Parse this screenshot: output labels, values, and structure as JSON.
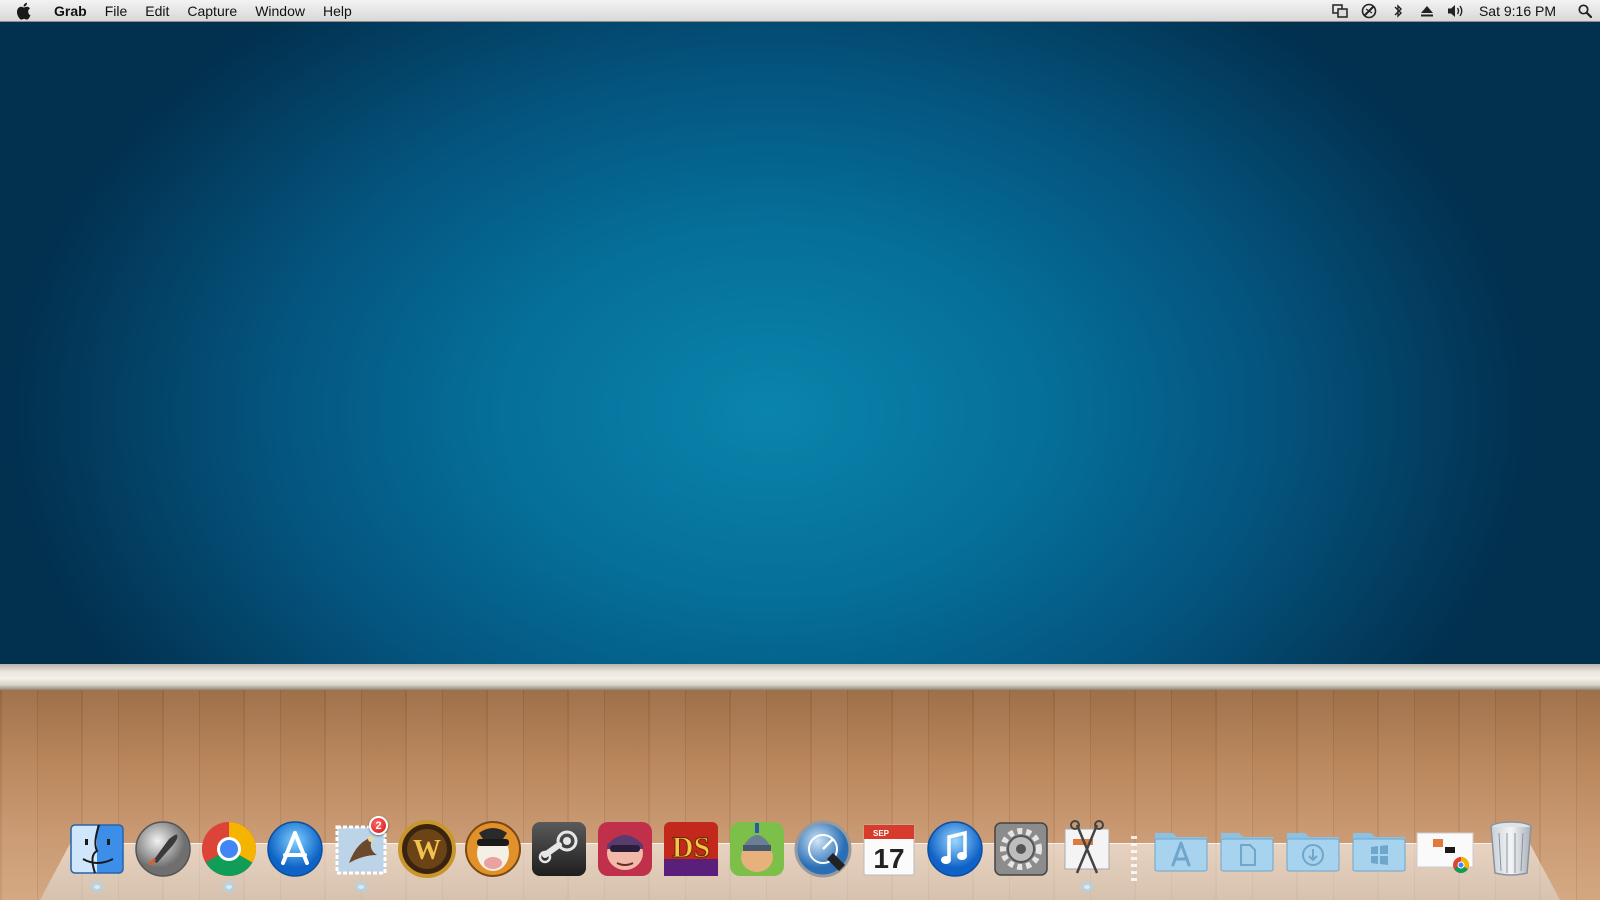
{
  "menubar": {
    "app_name": "Grab",
    "menus": [
      "File",
      "Edit",
      "Capture",
      "Window",
      "Help"
    ],
    "status_icons": [
      "window-switch-icon",
      "safari-sync-icon",
      "bluetooth-icon",
      "eject-icon",
      "volume-icon"
    ],
    "clock": "Sat 9:16 PM"
  },
  "dock": {
    "apps": [
      {
        "name": "finder-icon",
        "running": true
      },
      {
        "name": "launchpad-icon",
        "running": false
      },
      {
        "name": "chrome-icon",
        "running": true
      },
      {
        "name": "app-store-icon",
        "running": false
      },
      {
        "name": "mail-icon",
        "running": true,
        "badge": "2"
      },
      {
        "name": "world-of-warcraft-icon",
        "running": false
      },
      {
        "name": "cartoon-cow-game-icon",
        "running": false
      },
      {
        "name": "steam-icon",
        "running": false
      },
      {
        "name": "cartoon-thief-game-icon",
        "running": false
      },
      {
        "name": "ds-game-icon",
        "running": false
      },
      {
        "name": "cartoon-knight-game-icon",
        "running": false
      },
      {
        "name": "network-utility-icon",
        "running": false
      },
      {
        "name": "calendar-icon",
        "running": false,
        "calendar_month": "SEP",
        "calendar_day": "17"
      },
      {
        "name": "itunes-icon",
        "running": false
      },
      {
        "name": "system-preferences-icon",
        "running": false
      },
      {
        "name": "scissors-utility-icon",
        "running": true
      }
    ],
    "stacks": [
      {
        "name": "applications-folder-icon"
      },
      {
        "name": "documents-folder-icon"
      },
      {
        "name": "downloads-folder-icon"
      },
      {
        "name": "windows-folder-icon"
      },
      {
        "name": "chrome-file-stack-icon"
      },
      {
        "name": "trash-icon"
      }
    ]
  },
  "colors": {
    "wallpaper_center": "#0a84ab",
    "wallpaper_edge": "#02304f",
    "floor": "#c99870"
  }
}
